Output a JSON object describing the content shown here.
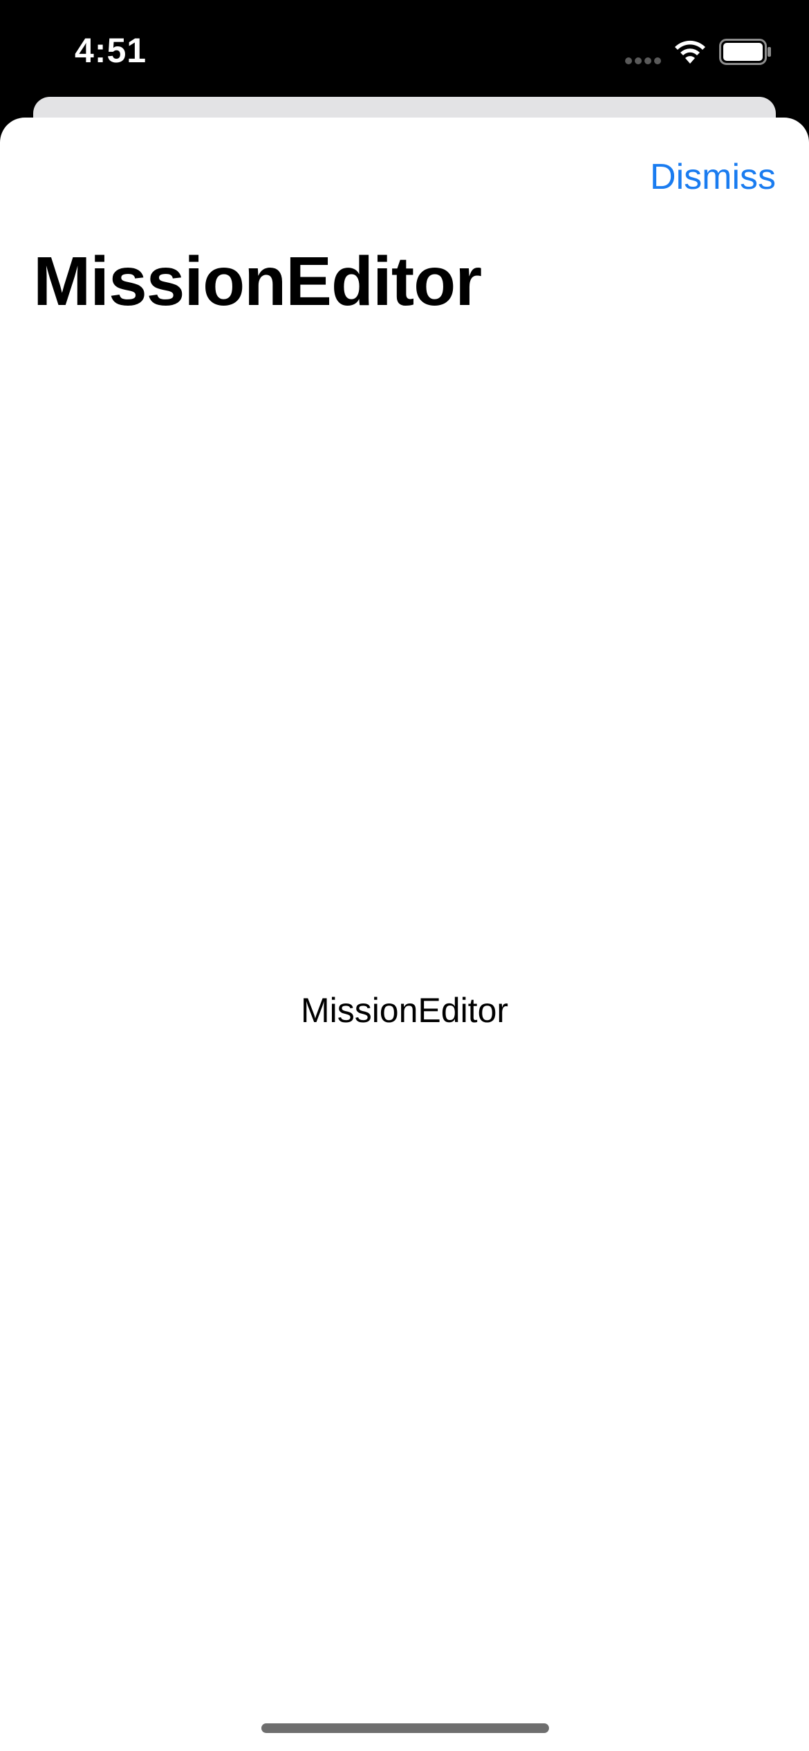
{
  "status_bar": {
    "time": "4:51",
    "icons": [
      "cellular-signal-icon",
      "wifi-icon",
      "battery-icon"
    ]
  },
  "sheet": {
    "dismiss_label": "Dismiss",
    "title": "MissionEditor",
    "body_text": "MissionEditor"
  },
  "colors": {
    "accent": "#1a7cf0",
    "status_bar_bg": "#000000",
    "sheet_bg": "#ffffff",
    "back_card_bg": "#e3e3e5"
  }
}
